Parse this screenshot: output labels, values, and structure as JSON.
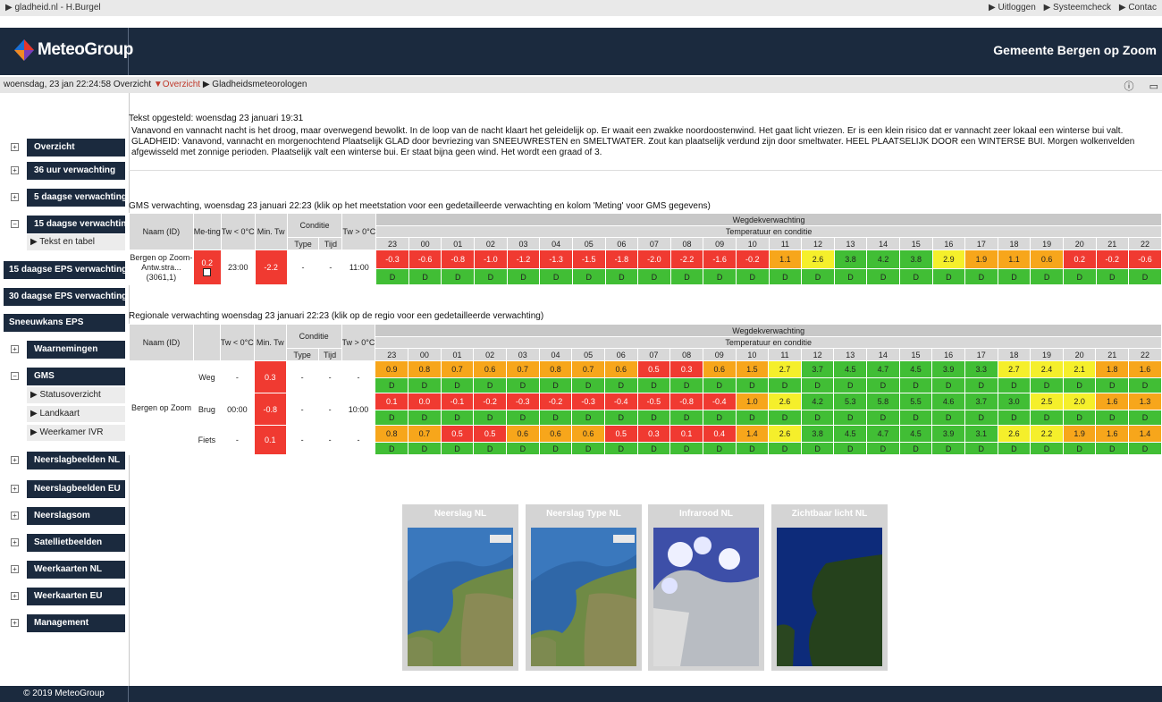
{
  "topbar": {
    "site": "▶ gladheid.nl - H.Burgel",
    "links": [
      "▶ Uitloggen",
      "▶ Systeemcheck",
      "▶ Contac"
    ]
  },
  "header": {
    "brand": "MeteoGroup",
    "org": "Gemeente Bergen op Zoom"
  },
  "subbar": {
    "datetime": "woensdag, 23 jan 22:24:58",
    "crumb_overview": "Overzicht",
    "crumb_active": "▼Overzicht",
    "crumb_next": "▶ Gladheidsmeteorologen",
    "icons": [
      "info-icon",
      "window-icon"
    ]
  },
  "sidebar": {
    "items": [
      {
        "label": "Overzicht",
        "expander": "+"
      },
      {
        "label": "36 uur verwachting",
        "expander": "+"
      },
      {
        "label": "5 daagse verwachting",
        "expander": "+"
      },
      {
        "label": "15 daagse verwachting",
        "expander": "−"
      },
      {
        "label": "▶ Tekst en tabel"
      },
      {
        "label": "15 daagse EPS verwachting"
      },
      {
        "label": "30 daagse EPS verwachting"
      },
      {
        "label": "Sneeuwkans EPS"
      },
      {
        "label": "Waarnemingen",
        "expander": "+"
      },
      {
        "label": "GMS",
        "expander": "−"
      },
      {
        "label": "▶ Statusoverzicht"
      },
      {
        "label": "▶ Landkaart"
      },
      {
        "label": "▶ Weerkamer IVR"
      },
      {
        "label": "Neerslagbeelden NL",
        "expander": "+"
      },
      {
        "label": "Neerslagbeelden EU",
        "expander": "+"
      },
      {
        "label": "Neerslagsom",
        "expander": "+"
      },
      {
        "label": "Satellietbeelden",
        "expander": "+"
      },
      {
        "label": "Weerkaarten NL",
        "expander": "+"
      },
      {
        "label": "Weerkaarten EU",
        "expander": "+"
      },
      {
        "label": "Management",
        "expander": "+"
      }
    ]
  },
  "forecast": {
    "issued": "Tekst opgesteld: woensdag 23 januari 19:31",
    "text": "Vanavond en vannacht nacht is het droog, maar overwegend bewolkt. In de loop van de nacht klaart het geleidelijk op. Er waait een zwakke noordoostenwind. Het gaat licht vriezen. Er is een klein risico dat er vannacht zeer lokaal een winterse bui valt. GLADHEID: Vanavond, vannacht en morgenochtend Plaatselijk GLAD door bevriezing van SNEEUWRESTEN en SMELTWATER. Zout kan plaatselijk verdund zijn door smeltwater. HEEL PLAATSELIJK DOOR een WINTERSE BUI. Morgen wolkenvelden afgewisseld met zonnige perioden. Plaatselijk valt een winterse bui. Er staat bijna geen wind. Het wordt een graad of 3."
  },
  "hours": [
    "23",
    "00",
    "01",
    "02",
    "03",
    "04",
    "05",
    "06",
    "07",
    "08",
    "09",
    "10",
    "11",
    "12",
    "13",
    "14",
    "15",
    "16",
    "17",
    "18",
    "19",
    "20",
    "21",
    "22"
  ],
  "gms": {
    "title": "GMS verwachting, woensdag 23 januari 22:23 (klik op het meetstation voor een gedetailleerde verwachting en kolom 'Meting' voor GMS gegevens)",
    "headers": {
      "name": "Naam (ID)",
      "meting": "Me-ting",
      "tw0": "Tw < 0°C",
      "mintw": "Min. Tw",
      "conditie": "Conditie",
      "type": "Type",
      "tijd": "Tijd",
      "twgt0": "Tw > 0°C",
      "wegdek": "Wegdekverwachting",
      "tempcond": "Temperatuur en conditie"
    },
    "row": {
      "name": "Bergen op Zoom-Antw.stra... (3061,1)",
      "meting": "0.2",
      "tw0": "23:00",
      "mintw": "-2.2",
      "type": "-",
      "tijd": "-",
      "twgt0": "11:00",
      "temps": [
        "-0.3",
        "-0.6",
        "-0.8",
        "-1.0",
        "-1.2",
        "-1.3",
        "-1.5",
        "-1.8",
        "-2.0",
        "-2.2",
        "-1.6",
        "-0.2",
        "1.1",
        "2.6",
        "3.8",
        "4.2",
        "3.8",
        "2.9",
        "1.9",
        "1.1",
        "0.6",
        "0.2",
        "-0.2",
        "-0.6"
      ],
      "cond": "D"
    }
  },
  "regional": {
    "title": "Regionale verwachting woensdag 23 januari 22:23 (klik op de regio voor een gedetailleerde verwachting)",
    "headers": {
      "name": "Naam (ID)",
      "tw0": "Tw < 0°C",
      "mintw": "Min. Tw",
      "conditie": "Conditie",
      "type": "Type",
      "tijd": "Tijd",
      "twgt0": "Tw > 0°C",
      "wegdek": "Wegdekverwachting",
      "tempcond": "Temperatuur en conditie"
    },
    "region": "Bergen op Zoom",
    "rows": [
      {
        "kind": "Weg",
        "tw0": "-",
        "mintw": "0.3",
        "type": "-",
        "tijd": "-",
        "twgt0": "-",
        "temps": [
          "0.9",
          "0.8",
          "0.7",
          "0.6",
          "0.7",
          "0.8",
          "0.7",
          "0.6",
          "0.5",
          "0.3",
          "0.6",
          "1.5",
          "2.7",
          "3.7",
          "4.5",
          "4.7",
          "4.5",
          "3.9",
          "3.3",
          "2.7",
          "2.4",
          "2.1",
          "1.8",
          "1.6"
        ]
      },
      {
        "kind": "Brug",
        "tw0": "00:00",
        "mintw": "-0.8",
        "type": "-",
        "tijd": "-",
        "twgt0": "10:00",
        "temps": [
          "0.1",
          "0.0",
          "-0.1",
          "-0.2",
          "-0.3",
          "-0.2",
          "-0.3",
          "-0.4",
          "-0.5",
          "-0.8",
          "-0.4",
          "1.0",
          "2.6",
          "4.2",
          "5.3",
          "5.8",
          "5.5",
          "4.6",
          "3.7",
          "3.0",
          "2.5",
          "2.0",
          "1.6",
          "1.3"
        ]
      },
      {
        "kind": "Fiets",
        "tw0": "-",
        "mintw": "0.1",
        "type": "-",
        "tijd": "-",
        "twgt0": "-",
        "temps": [
          "0.8",
          "0.7",
          "0.5",
          "0.5",
          "0.6",
          "0.6",
          "0.6",
          "0.5",
          "0.3",
          "0.1",
          "0.4",
          "1.4",
          "2.6",
          "3.8",
          "4.5",
          "4.7",
          "4.5",
          "3.9",
          "3.1",
          "2.6",
          "2.2",
          "1.9",
          "1.6",
          "1.4"
        ]
      }
    ],
    "cond": "D"
  },
  "tiles": [
    {
      "title": "Neerslag NL",
      "kind": "map"
    },
    {
      "title": "Neerslag Type NL",
      "kind": "map"
    },
    {
      "title": "Infrarood NL",
      "kind": "ir"
    },
    {
      "title": "Zichtbaar licht NL",
      "kind": "vis"
    }
  ],
  "footer": {
    "copyright": "© 2019 MeteoGroup"
  },
  "colors": {
    "navy": "#1b2a3e",
    "red": "#f03a31",
    "orange": "#f7a61b",
    "yellow": "#f5ef2b",
    "green": "#41be35"
  }
}
